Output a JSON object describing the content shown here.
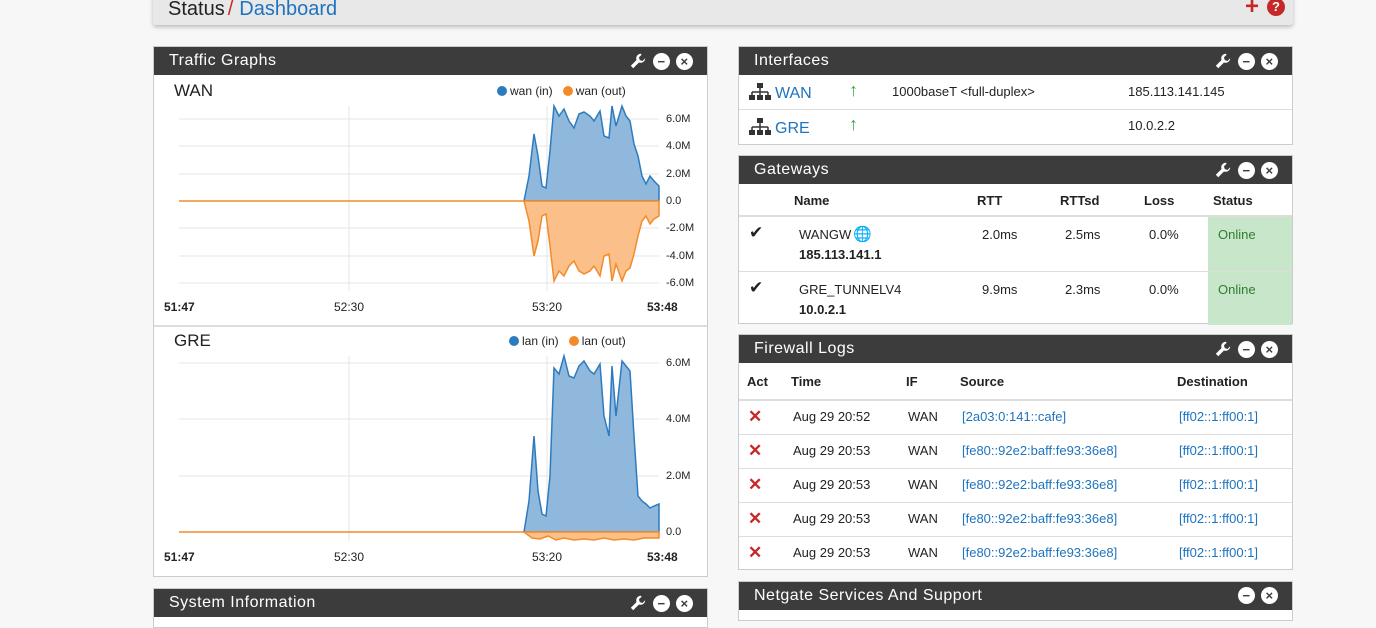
{
  "header": {
    "crumb_status": "Status",
    "crumb_sep": "/",
    "crumb_dashboard": "Dashboard",
    "add_label": "+",
    "help_label": "?"
  },
  "colors": {
    "accent_red": "#c62828",
    "link_blue": "#1e73be",
    "panel_dark": "#3c3c3c",
    "in_blue": "#2d7bbf",
    "out_orange": "#f28c28",
    "online_green": "#c8e6c9"
  },
  "traffic": {
    "title": "Traffic Graphs",
    "graphs": [
      {
        "name": "WAN",
        "legend_in": "wan (in)",
        "legend_out": "wan (out)",
        "yticks": [
          "6.0M",
          "4.0M",
          "2.0M",
          "0.0",
          "-2.0M",
          "-4.0M",
          "-6.0M"
        ],
        "xticks": [
          "51:47",
          "52:30",
          "53:20",
          "53:48"
        ]
      },
      {
        "name": "GRE",
        "legend_in": "lan (in)",
        "legend_out": "lan (out)",
        "yticks": [
          "6.0M",
          "4.0M",
          "2.0M",
          "0.0"
        ],
        "xticks": [
          "51:47",
          "52:30",
          "53:20",
          "53:48"
        ]
      }
    ]
  },
  "interfaces": {
    "title": "Interfaces",
    "rows": [
      {
        "name": "WAN",
        "media": "1000baseT <full-duplex>",
        "ip": "185.113.141.145"
      },
      {
        "name": "GRE",
        "media": "",
        "ip": "10.0.2.2"
      }
    ]
  },
  "gateways": {
    "title": "Gateways",
    "cols": [
      "Name",
      "RTT",
      "RTTsd",
      "Loss",
      "Status"
    ],
    "rows": [
      {
        "name": "WANGW",
        "ip": "185.113.141.1",
        "rtt": "2.0ms",
        "rttsd": "2.5ms",
        "loss": "0.0%",
        "status": "Online"
      },
      {
        "name": "GRE_TUNNELV4",
        "ip": "10.0.2.1",
        "rtt": "9.9ms",
        "rttsd": "2.3ms",
        "loss": "0.0%",
        "status": "Online"
      }
    ]
  },
  "firewall": {
    "title": "Firewall Logs",
    "cols": [
      "Act",
      "Time",
      "IF",
      "Source",
      "Destination"
    ],
    "rows": [
      {
        "time": "Aug 29 20:52",
        "if": "WAN",
        "src": "[2a03:0:141::cafe]",
        "dst": "[ff02::1:ff00:1]"
      },
      {
        "time": "Aug 29 20:53",
        "if": "WAN",
        "src": "[fe80::92e2:baff:fe93:36e8]",
        "dst": "[ff02::1:ff00:1]"
      },
      {
        "time": "Aug 29 20:53",
        "if": "WAN",
        "src": "[fe80::92e2:baff:fe93:36e8]",
        "dst": "[ff02::1:ff00:1]"
      },
      {
        "time": "Aug 29 20:53",
        "if": "WAN",
        "src": "[fe80::92e2:baff:fe93:36e8]",
        "dst": "[ff02::1:ff00:1]"
      },
      {
        "time": "Aug 29 20:53",
        "if": "WAN",
        "src": "[fe80::92e2:baff:fe93:36e8]",
        "dst": "[ff02::1:ff00:1]"
      }
    ]
  },
  "system_info": {
    "title": "System Information"
  },
  "netgate": {
    "title": "Netgate Services And Support"
  }
}
